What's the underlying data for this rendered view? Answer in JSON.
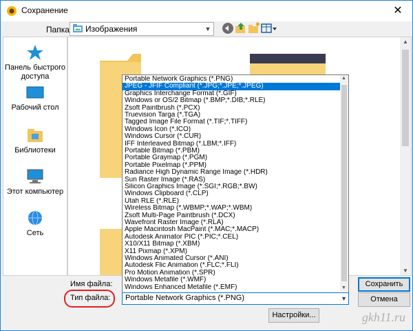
{
  "window": {
    "title": "Сохранение",
    "close_glyph": "✕"
  },
  "toolbar": {
    "folder_label": "Папка:",
    "folder_value": "Изображения",
    "icons": [
      "back-icon",
      "up-folder-icon",
      "new-folder-icon",
      "view-menu-icon"
    ]
  },
  "sidebar": {
    "items": [
      {
        "label": "Панель быстрого доступа",
        "icon": "star-icon"
      },
      {
        "label": "Рабочий стол",
        "icon": "desktop-icon"
      },
      {
        "label": "Библиотеки",
        "icon": "libraries-icon"
      },
      {
        "label": "Этот компьютер",
        "icon": "computer-icon"
      },
      {
        "label": "Сеть",
        "icon": "network-icon"
      }
    ]
  },
  "dropdown": {
    "selected_index": 1,
    "options": [
      "Portable Network Graphics (*.PNG)",
      "JPEG - JFIF Compliant (*.JPG;*.JPE;*.JPEG)",
      "Graphics Interchange Format (*.GIF)",
      "Windows or OS/2 Bitmap (*.BMP;*.DIB;*.RLE)",
      "Zsoft Paintbrush (*.PCX)",
      "Truevision Targa (*.TGA)",
      "Tagged Image File Format (*.TIF;*.TIFF)",
      "Windows Icon (*.ICO)",
      "Windows Cursor (*.CUR)",
      "IFF Interleaved Bitmap (*.LBM;*.IFF)",
      "Portable Bitmap (*.PBM)",
      "Portable Graymap (*.PGM)",
      "Portable Pixelmap (*.PPM)",
      "Radiance High Dynamic Range Image (*.HDR)",
      "Sun Raster Image (*.RAS)",
      "Silicon Graphics Image (*.SGI;*.RGB;*.BW)",
      "Windows Clipboard (*.CLP)",
      "Utah RLE (*.RLE)",
      "Wireless Bitmap (*.WBMP;*.WAP;*.WBM)",
      "Zsoft Multi-Page Paintbrush (*.DCX)",
      "Wavefront Raster Image (*.RLA)",
      "Apple Macintosh MacPaint (*.MAC;*.MACP)",
      "Autodesk Animator PIC (*.PIC;*.CEL)",
      "X10/X11 Bitmap (*.XBM)",
      "X11 Pixmap (*.XPM)",
      "Windows Animated Cursor (*.ANI)",
      "Autodesk Flic Animation (*.FLC;*.FLI)",
      "Pro Motion Animation (*.SPR)",
      "Windows Metafile (*.WMF)",
      "Windows Enhanced Metafile (*.EMF)"
    ]
  },
  "footer": {
    "filename_label": "Имя файла:",
    "filetype_label": "Тип файла:",
    "filetype_value": "Portable Network Graphics (*.PNG)",
    "save_label": "Сохранить",
    "cancel_label": "Отмена",
    "settings_label": "Настройки..."
  },
  "watermark": "gkh11.ru",
  "colors": {
    "accent": "#0078d7",
    "highlight": "#e02020",
    "folder": "#f2c45a"
  }
}
